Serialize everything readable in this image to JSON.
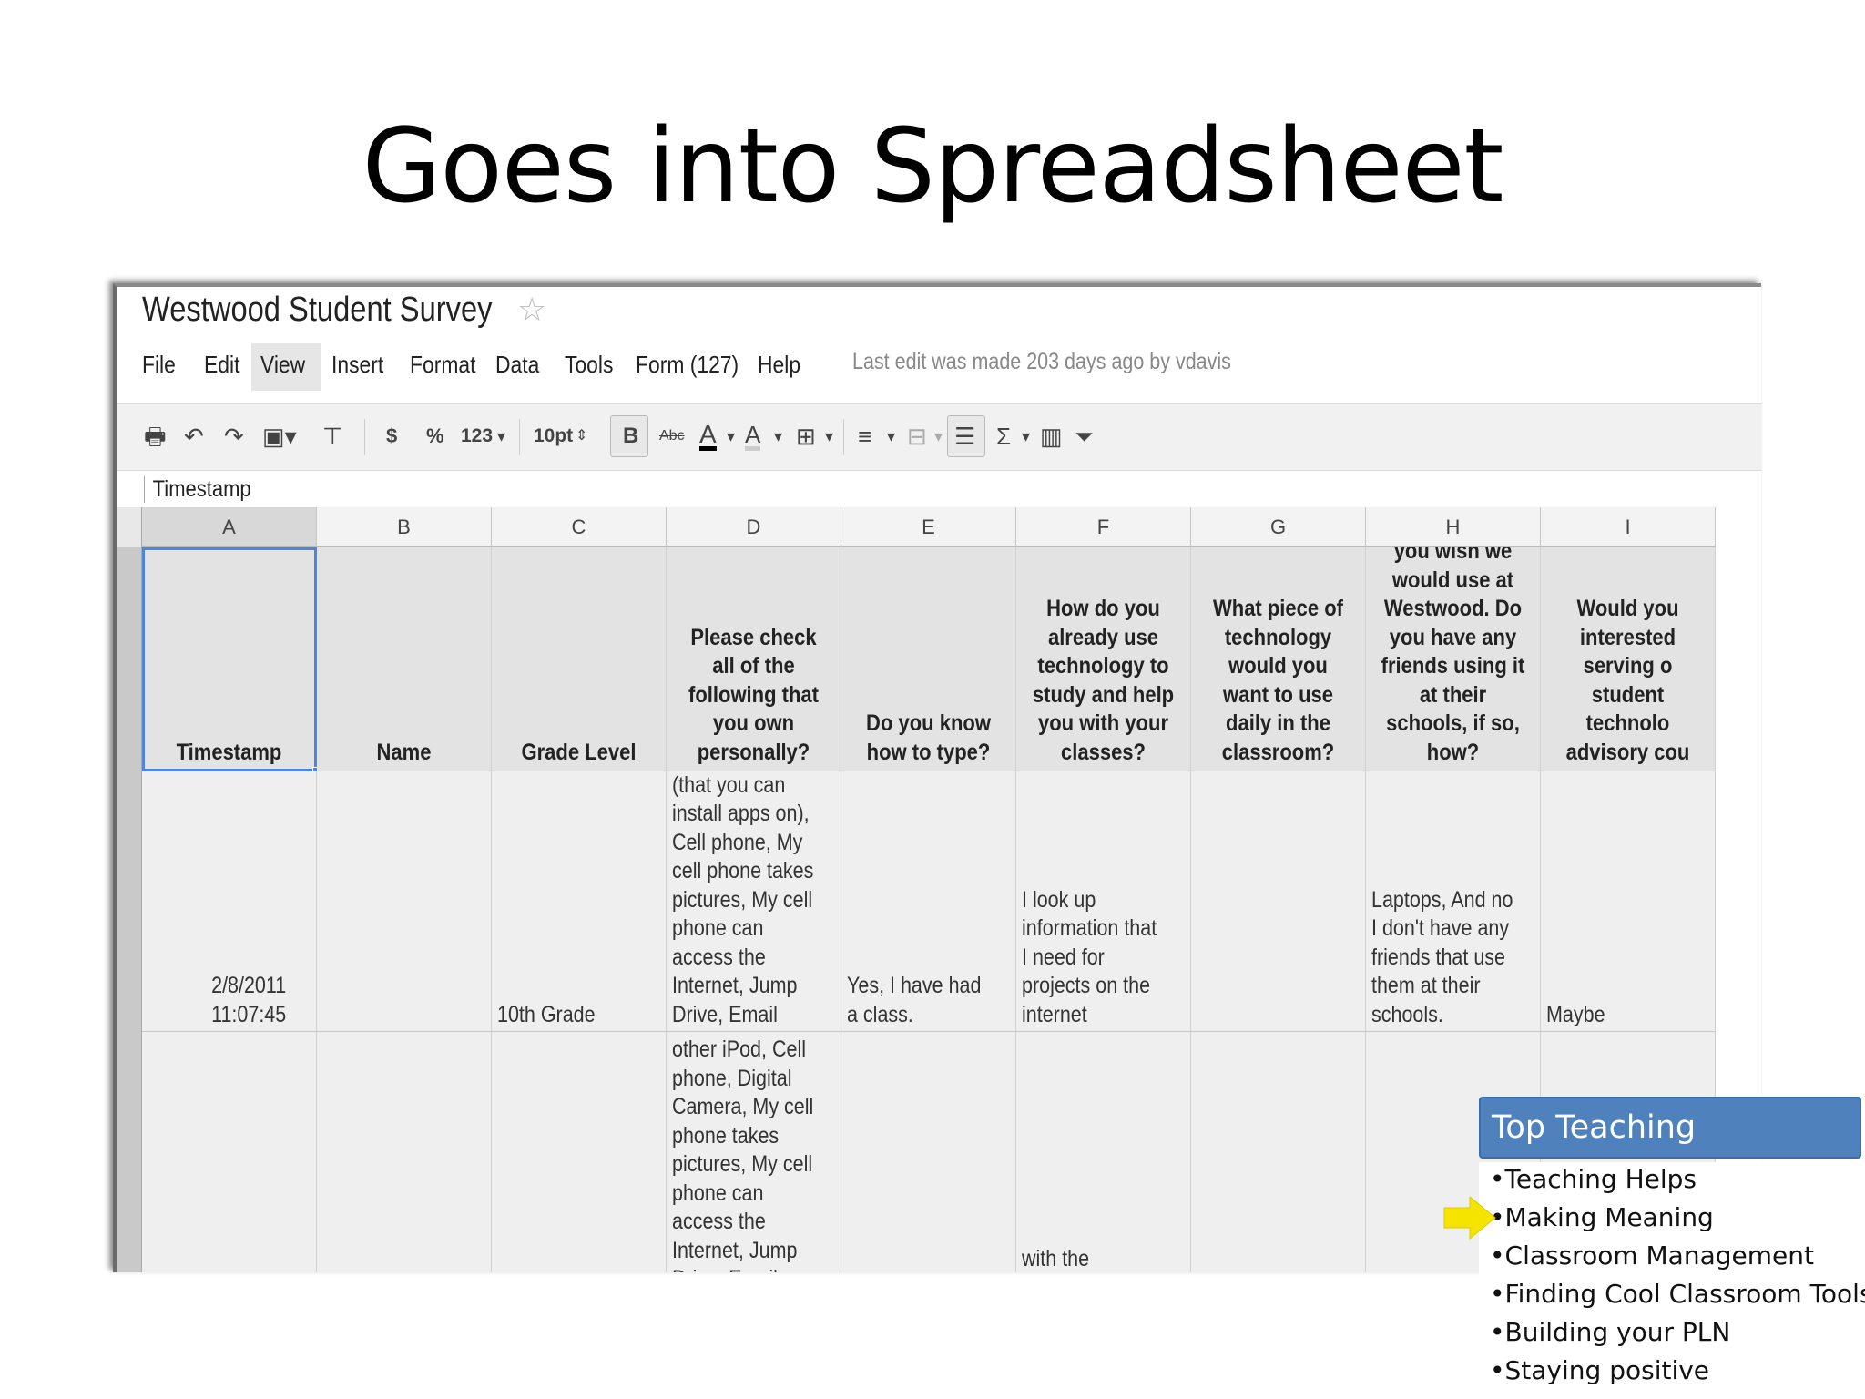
{
  "slide": {
    "title": "Goes into Spreadsheet"
  },
  "app": {
    "doc_title": "Westwood Student Survey",
    "star_icon": "star-icon",
    "menu": [
      "File",
      "Edit",
      "View",
      "Insert",
      "Format",
      "Data",
      "Tools",
      "Form (127)",
      "Help"
    ],
    "last_edit": "Last edit was made 203 days ago by vdavis",
    "toolbar": {
      "currency": "$",
      "percent": "%",
      "number_format": "123",
      "font_size": "10pt",
      "bold": "B",
      "strikethrough": "Abc",
      "text_color": "A",
      "fill_color": "A",
      "sum": "Σ"
    },
    "formula_bar": "Timestamp",
    "columns": [
      "A",
      "B",
      "C",
      "D",
      "E",
      "F",
      "G",
      "H",
      "I"
    ],
    "headers": [
      "Timestamp",
      "Name",
      "Grade Level",
      "Please check all of the following that you own personally?",
      "Do you know how to type?",
      "How do you already use technology to study and help you with your classes?",
      "What piece of technology would you want to use daily in the classroom?",
      "What is a technology you wish we would use at Westwood. Do you have any friends using it at their schools, if so, how?",
      "Would you interested serving o student technolo advisory cou"
    ],
    "rows": [
      [
        "2/8/2011 11:07:45",
        "",
        "10th Grade",
        "iPod Touch, Smart phone (that you can install apps on), Cell phone, My cell phone takes pictures, My cell phone can access the Internet, Jump Drive, Email",
        "Yes, I have had a class.",
        "I look up information that I need for projects on the internet",
        "",
        "Laptops, And no I don't have any friends that use them at their schools.",
        "Maybe"
      ],
      [
        "",
        "",
        "",
        "other iPod, Cell phone, Digital Camera, My cell phone takes pictures, My cell phone can access the Internet, Jump Drive, Email",
        "",
        "with the computers",
        "",
        "",
        ""
      ]
    ]
  },
  "panel": {
    "title": "Top Teaching",
    "items": [
      "•Teaching Helps",
      "•Making Meaning",
      "•Classroom Management",
      "•Finding Cool Classroom Tools",
      "•Building your PLN",
      "•Staying positive"
    ],
    "arrow_color": "#f5e400",
    "header_color": "#4f81bd"
  }
}
